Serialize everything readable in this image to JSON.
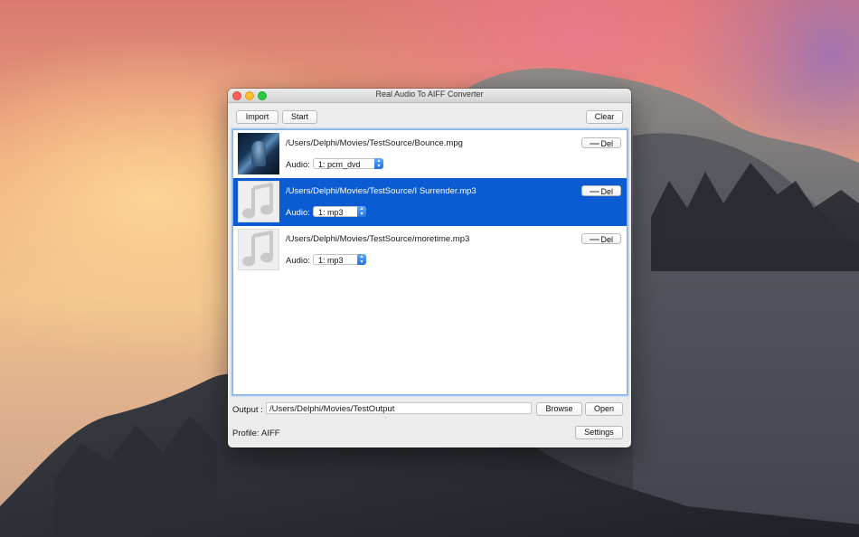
{
  "window": {
    "title": "Real Audio To AIFF Converter"
  },
  "toolbar": {
    "import_label": "Import",
    "start_label": "Start",
    "clear_label": "Clear"
  },
  "files": [
    {
      "path": "/Users/Delphi/Movies/TestSource/Bounce.mpg",
      "thumbnail": "video-frame",
      "audio_label": "Audio:",
      "audio_track": "1: pcm_dvd",
      "delete_label": "Del",
      "selected": false
    },
    {
      "path": "/Users/Delphi/Movies/TestSource/I Surrender.mp3",
      "thumbnail": "music-note-icon",
      "audio_label": "Audio:",
      "audio_track": "1: mp3",
      "delete_label": "Del",
      "selected": true
    },
    {
      "path": "/Users/Delphi/Movies/TestSource/moretime.mp3",
      "thumbnail": "music-note-icon",
      "audio_label": "Audio:",
      "audio_track": "1: mp3",
      "delete_label": "Del",
      "selected": false
    }
  ],
  "output": {
    "label": "Output :",
    "path": "/Users/Delphi/Movies/TestOutput",
    "browse_label": "Browse",
    "open_label": "Open"
  },
  "profile": {
    "label": "Profile:",
    "value": "AIFF",
    "settings_label": "Settings"
  },
  "colors": {
    "selection": "#0b5bd3",
    "close": "#fc5f57",
    "minimize": "#fdbc2e",
    "zoom": "#29c940",
    "stepper": "#1f73e6"
  }
}
